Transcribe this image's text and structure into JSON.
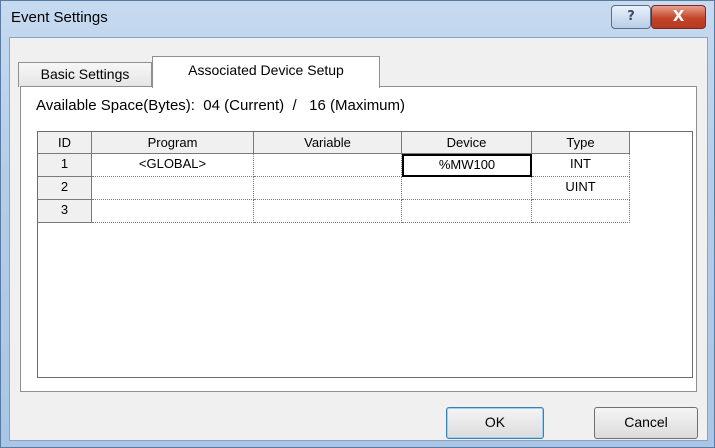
{
  "window": {
    "title": "Event Settings"
  },
  "titlebar": {
    "help_glyph": "?",
    "close_glyph": "X",
    "help_icon": "question-icon",
    "close_icon": "close-icon"
  },
  "tabs": [
    {
      "label": "Basic Settings",
      "active": false
    },
    {
      "label": "Associated Device Setup",
      "active": true
    }
  ],
  "available_space": {
    "text": "Available Space(Bytes):  04 (Current)  /   16 (Maximum)"
  },
  "table": {
    "headers": [
      "ID",
      "Program",
      "Variable",
      "Device",
      "Type"
    ],
    "rows": [
      {
        "id": "1",
        "program": "<GLOBAL>",
        "variable": "",
        "device": "%MW100",
        "type": "INT"
      },
      {
        "id": "2",
        "program": "",
        "variable": "",
        "device": "",
        "type": "UINT"
      },
      {
        "id": "3",
        "program": "",
        "variable": "",
        "device": "",
        "type": ""
      }
    ]
  },
  "buttons": {
    "ok": "OK",
    "cancel": "Cancel"
  },
  "colors": {
    "close_button": "#c4452a",
    "title_background": "#b4cde8",
    "dialog_background": "#f0f0f0"
  }
}
